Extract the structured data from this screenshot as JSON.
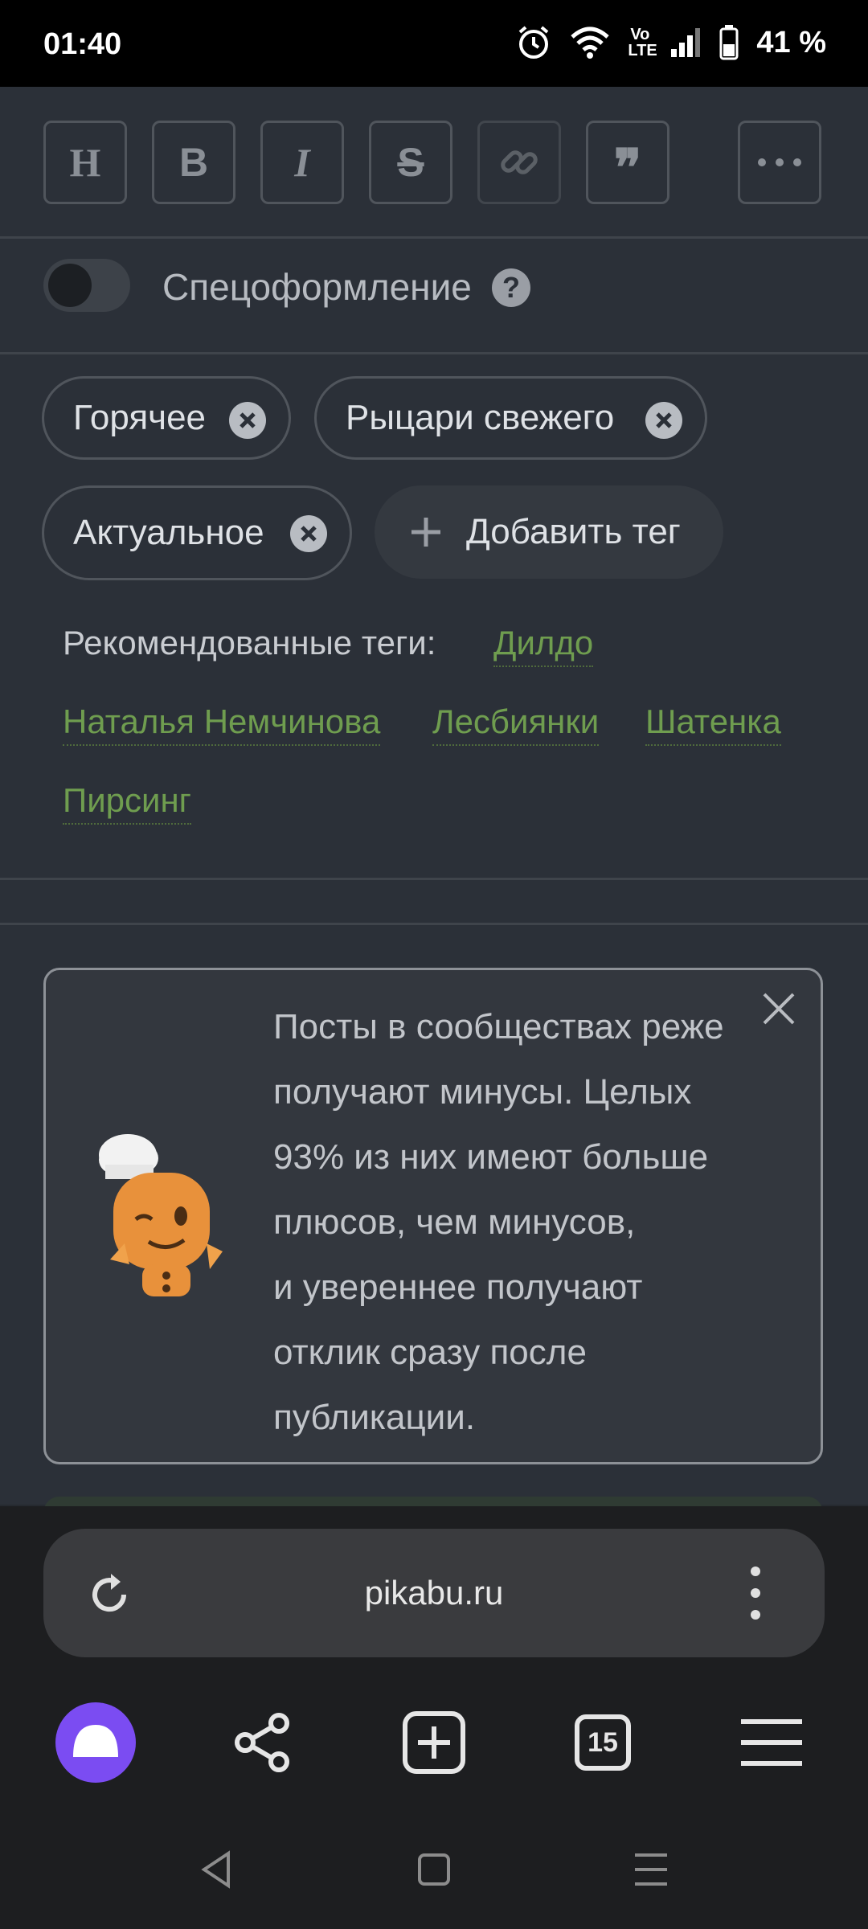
{
  "status_bar": {
    "time": "01:40",
    "battery": "41 %",
    "network": "Vo LTE"
  },
  "toolbar": {
    "buttons": [
      {
        "name": "heading",
        "glyph": "H"
      },
      {
        "name": "bold",
        "glyph": "B"
      },
      {
        "name": "italic",
        "glyph": "I"
      },
      {
        "name": "strikethrough",
        "glyph": "S"
      },
      {
        "name": "link",
        "glyph": "link-icon"
      },
      {
        "name": "quote",
        "glyph": "❞"
      },
      {
        "name": "more",
        "glyph": "more-icon"
      }
    ]
  },
  "special_format": {
    "label": "Спецоформление",
    "help": "?",
    "enabled": false
  },
  "tags": {
    "items": [
      "Горячее",
      "Рыцари свежего",
      "Актуальное"
    ],
    "add_label": "Добавить тег",
    "recommended_label": "Рекомендованные теги:",
    "recommended": [
      "Дилдо",
      "Наталья Немчинова",
      "Лесбиянки",
      "Шатенка",
      "Пирсинг"
    ]
  },
  "notice": {
    "lines": [
      "Посты в сообществах реже",
      "получают минусы. Целых",
      "93% из них имеют больше",
      "плюсов, чем минусов,",
      "и увереннее получают",
      "отклик сразу после",
      "публикации."
    ]
  },
  "browser": {
    "url": "pikabu.ru",
    "tabs_count": "15"
  },
  "colors": {
    "background": "#2b3038",
    "recommended_tag": "#6f9d4f",
    "alice_purple": "#7b4cf2"
  }
}
